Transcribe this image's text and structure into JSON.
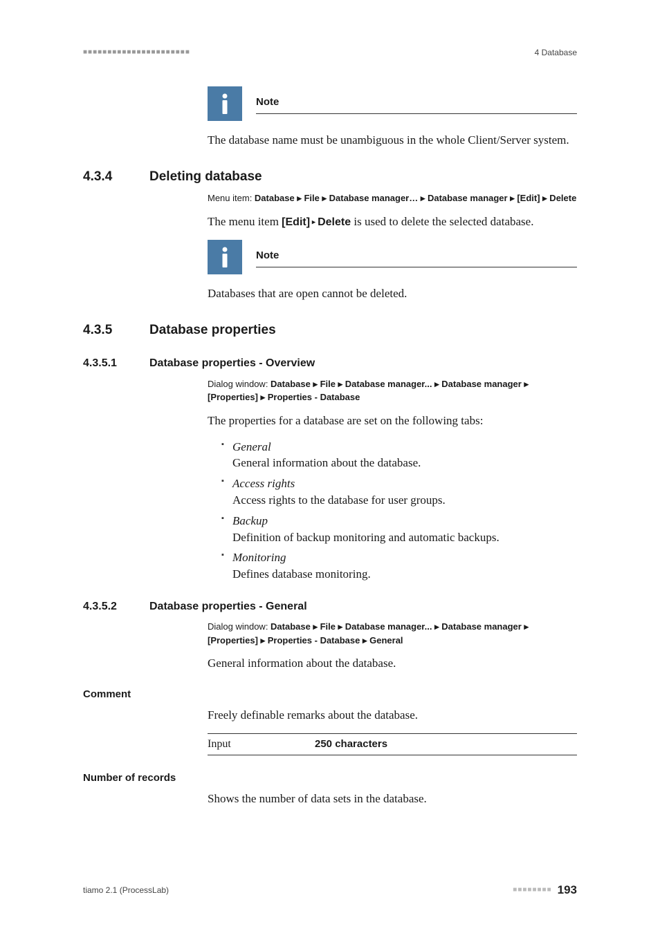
{
  "header": {
    "left_marks": "■■■■■■■■■■■■■■■■■■■■■■",
    "right": "4 Database"
  },
  "note1": {
    "title": "Note",
    "body": "The database name must be unambiguous in the whole Client/Server system."
  },
  "sec_434": {
    "num": "4.3.4",
    "title": "Deleting database",
    "menu_prefix": "Menu item: ",
    "menu_path": "Database ▸ File ▸ Database manager… ▸ Database manager ▸ [Edit] ▸ Delete",
    "body_prefix": "The menu item ",
    "body_bold1": "[Edit]",
    "body_arrow": " ▸ ",
    "body_bold2": "Delete",
    "body_suffix": " is used to delete the selected database."
  },
  "note2": {
    "title": "Note",
    "body": "Databases that are open cannot be deleted."
  },
  "sec_435": {
    "num": "4.3.5",
    "title": "Database properties"
  },
  "sec_4351": {
    "num": "4.3.5.1",
    "title": "Database properties - Overview",
    "menu_prefix": "Dialog window: ",
    "menu_path": "Database ▸ File ▸ Database manager... ▸ Database manager ▸ [Properties] ▸ Properties - Database",
    "intro": "The properties for a database are set on the following tabs:",
    "items": [
      {
        "name": "General",
        "desc": "General information about the database."
      },
      {
        "name": "Access rights",
        "desc": "Access rights to the database for user groups."
      },
      {
        "name": "Backup",
        "desc": "Definition of backup monitoring and automatic backups."
      },
      {
        "name": "Monitoring",
        "desc": "Defines database monitoring."
      }
    ]
  },
  "sec_4352": {
    "num": "4.3.5.2",
    "title": "Database properties - General",
    "menu_prefix": "Dialog window: ",
    "menu_path": "Database ▸ File ▸ Database manager... ▸ Database manager ▸ [Properties] ▸ Properties - Database ▸ General",
    "intro": "General information about the database."
  },
  "comment": {
    "label": "Comment",
    "body": "Freely definable remarks about the database.",
    "input_label": "Input",
    "input_value": "250 characters"
  },
  "records": {
    "label": "Number of records",
    "body": "Shows the number of data sets in the database."
  },
  "footer": {
    "left": "tiamo 2.1 (ProcessLab)",
    "dots": "■■■■■■■■",
    "page": "193"
  }
}
